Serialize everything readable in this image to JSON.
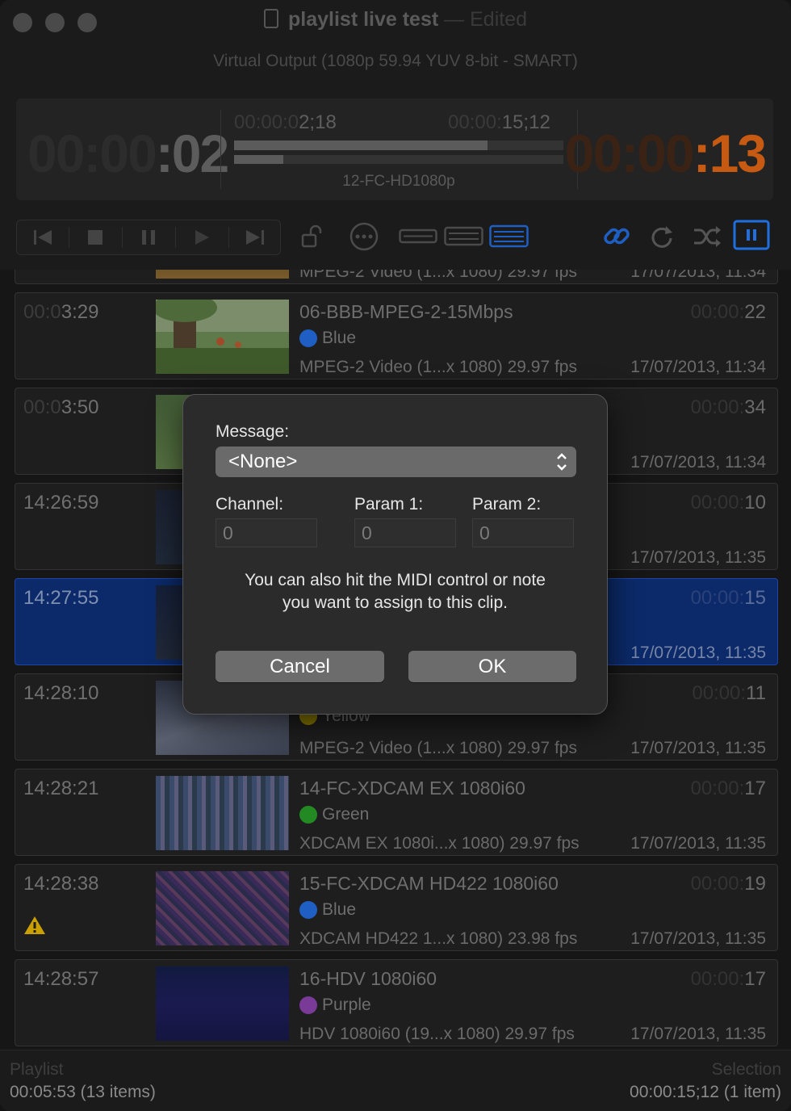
{
  "window": {
    "title": "playlist live test",
    "title_separator": "—",
    "title_state": "Edited",
    "subtitle": "Virtual Output (1080p 59.94 YUV 8-bit - SMART)"
  },
  "status": {
    "elapsed_dim": "00:00",
    "elapsed_bright": ":02",
    "clip_elapsed_dim": "00:00:0",
    "clip_elapsed": "2;18",
    "clip_duration_dim": "00:00:",
    "clip_duration": "15;12",
    "remaining_dim": "00:00",
    "remaining_bright": ":13",
    "clip_progress": 0.77,
    "playlist_progress": 0.15,
    "clip_name": "12-FC-HD1080p",
    "remaining_color": "#c65a12"
  },
  "toolbar": {
    "icons": [
      "skip-back-icon",
      "stop-icon",
      "pause-icon",
      "play-icon",
      "skip-forward-icon",
      "unlock-icon",
      "more-icon",
      "display-thin-icon",
      "display-medium-icon",
      "display-large-icon",
      "link-icon",
      "repeat-icon",
      "shuffle-icon",
      "pause-on-clip-icon"
    ],
    "accent": "#1f6fe0"
  },
  "rows": [
    {
      "time_dim": "",
      "time": "",
      "name": "",
      "tag_label": "",
      "tag_color": "",
      "meta": "MPEG-2 Video (1...x 1080) 29.97 fps",
      "date": "17/07/2013, 11:34",
      "dur_dim": "",
      "dur": ""
    },
    {
      "time_dim": "00:0",
      "time": "3:29",
      "name": "06-BBB-MPEG-2-15Mbps",
      "tag_label": "Blue",
      "tag_color": "#1f6fe0",
      "meta": "MPEG-2 Video (1...x 1080) 29.97 fps",
      "date": "17/07/2013, 11:34",
      "dur_dim": "00:00:",
      "dur": "22"
    },
    {
      "time_dim": "00:0",
      "time": "3:50",
      "name": "",
      "tag_label": "",
      "tag_color": "",
      "meta": "",
      "date": "17/07/2013, 11:34",
      "dur_dim": "00:00:",
      "dur": "34"
    },
    {
      "time_dim": "",
      "time": "14:26:59",
      "name": "",
      "tag_label": "",
      "tag_color": "",
      "meta": "",
      "date": "17/07/2013, 11:35",
      "dur_dim": "00:00:",
      "dur": "10"
    },
    {
      "time_dim": "",
      "time": "14:27:55",
      "name": "",
      "tag_label": "",
      "tag_color": "",
      "meta": "",
      "date": "17/07/2013, 11:35",
      "dur_dim": "00:00:",
      "dur": "15"
    },
    {
      "time_dim": "",
      "time": "14:28:10",
      "name": "",
      "tag_label": "Yellow",
      "tag_color": "#c9b400",
      "meta": "MPEG-2 Video (1...x 1080) 29.97 fps",
      "date": "17/07/2013, 11:35",
      "dur_dim": "00:00:",
      "dur": "11"
    },
    {
      "time_dim": "",
      "time": "14:28:21",
      "name": "14-FC-XDCAM EX 1080i60",
      "tag_label": "Green",
      "tag_color": "#2fb32f",
      "meta": "XDCAM EX 1080i...x 1080) 29.97 fps",
      "date": "17/07/2013, 11:35",
      "dur_dim": "00:00:",
      "dur": "17"
    },
    {
      "time_dim": "",
      "time": "14:28:38",
      "name": "15-FC-XDCAM HD422 1080i60",
      "tag_label": "Blue",
      "tag_color": "#1f6fe0",
      "meta": "XDCAM HD422 1...x 1080) 23.98 fps",
      "date": "17/07/2013, 11:35",
      "dur_dim": "00:00:",
      "dur": "19"
    },
    {
      "time_dim": "",
      "time": "14:28:57",
      "name": "16-HDV 1080i60",
      "tag_label": "Purple",
      "tag_color": "#a44fc9",
      "meta": "HDV 1080i60 (19...x 1080) 29.97 fps",
      "date": "17/07/2013, 11:35",
      "dur_dim": "00:00:",
      "dur": "17"
    }
  ],
  "footer": {
    "left_label": "Playlist",
    "left_value": "00:05:53 (13 items)",
    "right_label": "Selection",
    "right_value": "00:00:15;12 (1 item)"
  },
  "dialog": {
    "message_label": "Message:",
    "message_value": "<None>",
    "channel_label": "Channel:",
    "param1_label": "Param 1:",
    "param2_label": "Param 2:",
    "channel_placeholder": "0",
    "param1_placeholder": "0",
    "param2_placeholder": "0",
    "hint_line1": "You can also hit the MIDI control or note",
    "hint_line2": "you want to assign to this clip.",
    "cancel_label": "Cancel",
    "ok_label": "OK"
  }
}
